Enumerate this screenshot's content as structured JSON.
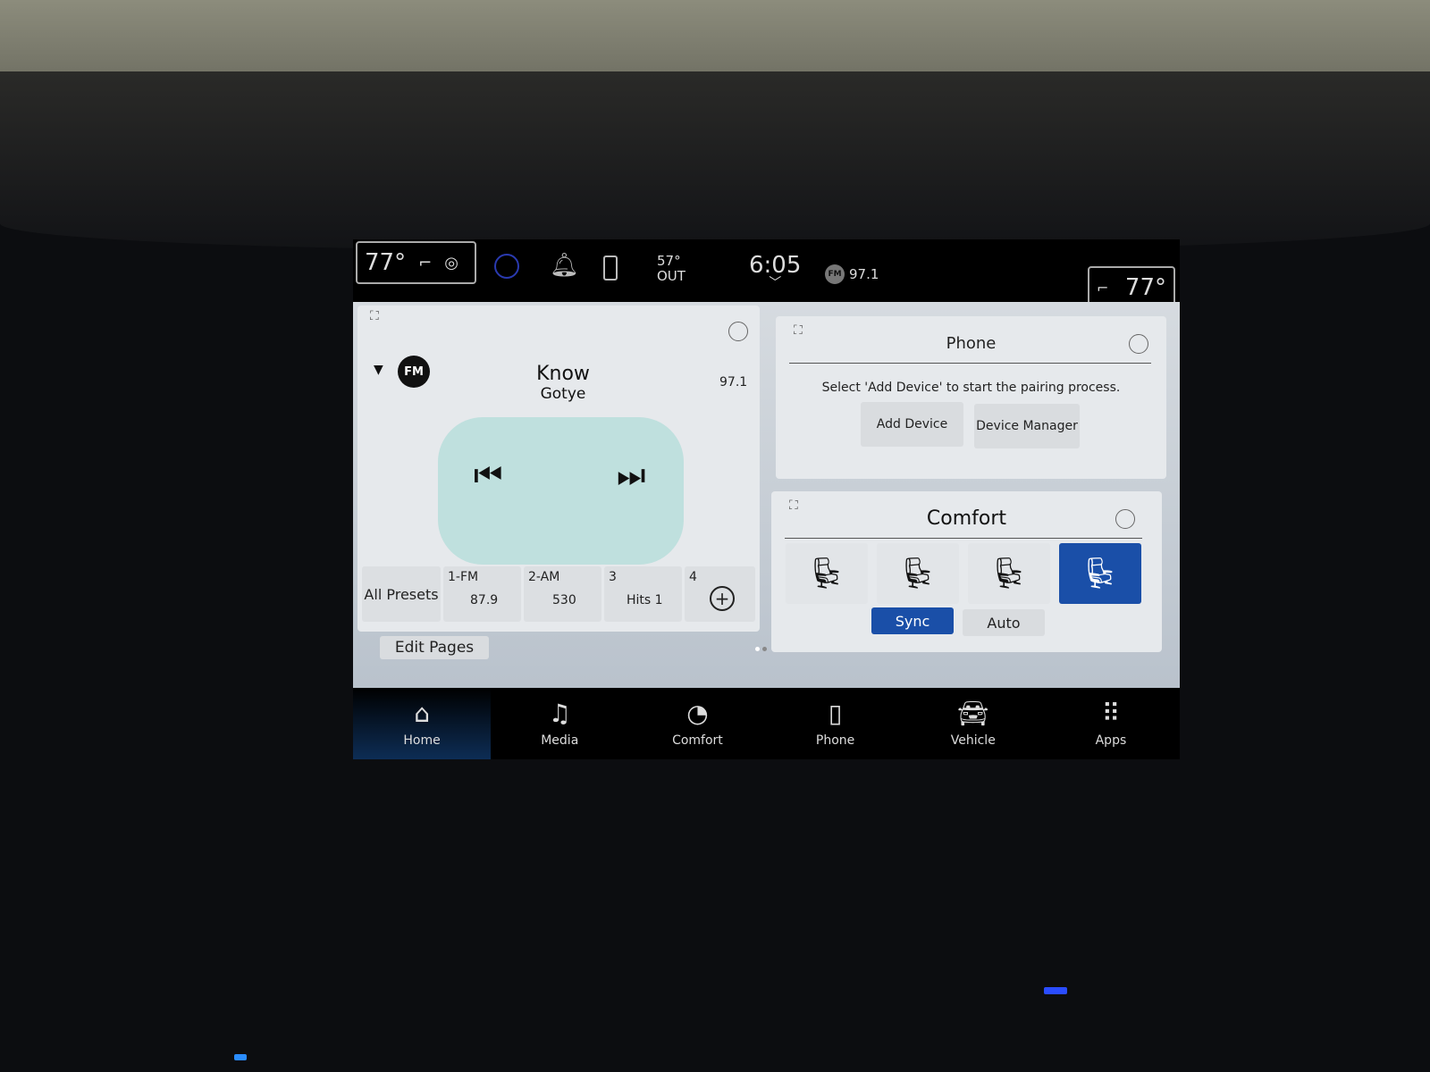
{
  "status_bar": {
    "driver_temp": "77°",
    "passenger_temp": "77°",
    "outside_temp": "57°",
    "outside_label": "OUT",
    "time": "6:05",
    "radio_band": "FM",
    "radio_station": "97.1"
  },
  "radio": {
    "band": "FM",
    "song": "Know",
    "artist": "Gotye",
    "frequency": "97.1",
    "presets": [
      {
        "label": "All Presets"
      },
      {
        "num": "1-FM",
        "value": "87.9"
      },
      {
        "num": "2-AM",
        "value": "530"
      },
      {
        "num": "3",
        "value": "Hits 1"
      },
      {
        "num": "4",
        "value": ""
      }
    ]
  },
  "edit_pages": "Edit Pages",
  "phone": {
    "title": "Phone",
    "message": "Select 'Add Device' to start the pairing process.",
    "add_device": "Add Device",
    "device_manager": "Device Manager"
  },
  "comfort": {
    "title": "Comfort",
    "sync": "Sync",
    "auto": "Auto",
    "accent": "#1a4fa8"
  },
  "nav": [
    {
      "label": "Home",
      "icon": "home-icon"
    },
    {
      "label": "Media",
      "icon": "music-note-icon"
    },
    {
      "label": "Comfort",
      "icon": "comfort-icon"
    },
    {
      "label": "Phone",
      "icon": "phone-icon"
    },
    {
      "label": "Vehicle",
      "icon": "car-icon"
    },
    {
      "label": "Apps",
      "icon": "grid-icon"
    }
  ]
}
